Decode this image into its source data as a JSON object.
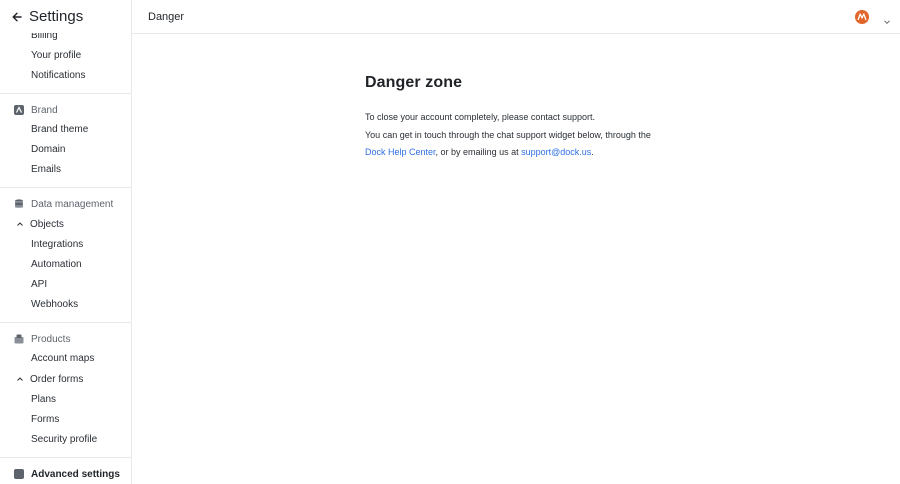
{
  "sidebar": {
    "title": "Settings",
    "top_items": [
      "Billing",
      "Your profile",
      "Notifications"
    ],
    "brand": {
      "label": "Brand",
      "items": [
        "Brand theme",
        "Domain",
        "Emails"
      ]
    },
    "data_management": {
      "label": "Data management",
      "objects_label": "Objects",
      "items": [
        "Integrations",
        "Automation",
        "API",
        "Webhooks"
      ]
    },
    "products": {
      "label": "Products",
      "items_before": [
        "Account maps"
      ],
      "order_forms_label": "Order forms",
      "items": [
        "Plans",
        "Forms",
        "Security profile"
      ]
    },
    "advanced": {
      "label": "Advanced settings"
    }
  },
  "header": {
    "breadcrumb": "Danger"
  },
  "main": {
    "title": "Danger zone",
    "para1": "To close your account completely, please contact support.",
    "para2_prefix": "You can get in touch through the chat support widget below, through the ",
    "para2_link": "Dock Help Center",
    "para2_mid": ", or by emailing us at ",
    "para2_email": "support@dock.us",
    "para2_suffix": "."
  },
  "colors": {
    "accent_link": "#2f6fe4",
    "avatar": "#e2662c",
    "border": "#e6e8eb"
  },
  "icons": [
    "back-arrow-icon",
    "brand-icon",
    "database-icon",
    "products-icon",
    "chevron-up-icon",
    "chevron-down-icon"
  ]
}
